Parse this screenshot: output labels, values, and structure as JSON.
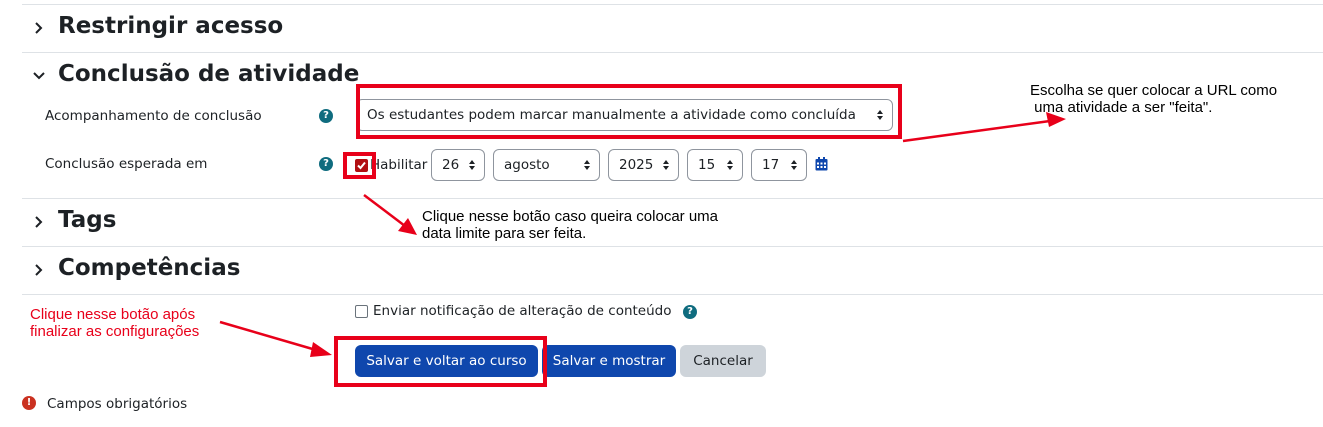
{
  "sections": {
    "restrict_access": "Restringir acesso",
    "activity_completion": "Conclusão de atividade",
    "tags": "Tags",
    "competencies": "Competências"
  },
  "completion": {
    "tracking_label": "Acompanhamento de conclusão",
    "tracking_value": "Os estudantes podem marcar manualmente a atividade como concluída",
    "expected_label": "Conclusão esperada em",
    "enable_label": "Habilitar",
    "enable_checked": true,
    "day": "26",
    "month": "agosto",
    "year": "2025",
    "hour": "15",
    "minute": "17"
  },
  "notify": {
    "label": "Enviar notificação de alteração de conteúdo",
    "checked": false
  },
  "buttons": {
    "save_return": "Salvar e voltar ao curso",
    "save_display": "Salvar e mostrar",
    "cancel": "Cancelar"
  },
  "required_note": "Campos obrigatórios",
  "annotations": {
    "url_line1": "Escolha se quer colocar a URL como",
    "url_line2": " uma atividade a ser \"feita\".",
    "date_line1": "Clique nesse botão caso queira colocar uma",
    "date_line2": "data limite para ser feita.",
    "save_line1": "Clique nesse botão após",
    "save_line2": "finalizar as configurações"
  },
  "colors": {
    "primary": "#0f47ad",
    "help": "#0f6c7f",
    "required": "#ca3120",
    "annotation": "#e8001a"
  }
}
